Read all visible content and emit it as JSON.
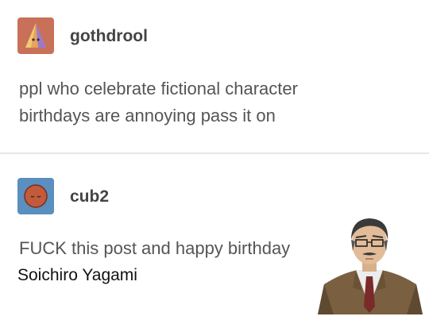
{
  "posts": [
    {
      "username": "gothdrool",
      "avatar_icon": "pyramid-ghost-icon",
      "avatar_color": "#c87058",
      "text_line_1": "ppl who celebrate fictional character",
      "text_line_2": "birthdays are annoying pass it on"
    },
    {
      "username": "cub2",
      "avatar_icon": "sleeping-ball-icon",
      "avatar_color": "#5a8fbf",
      "text": "FUCK this post and happy birthday"
    }
  ],
  "caption": "Soichiro Yagami"
}
